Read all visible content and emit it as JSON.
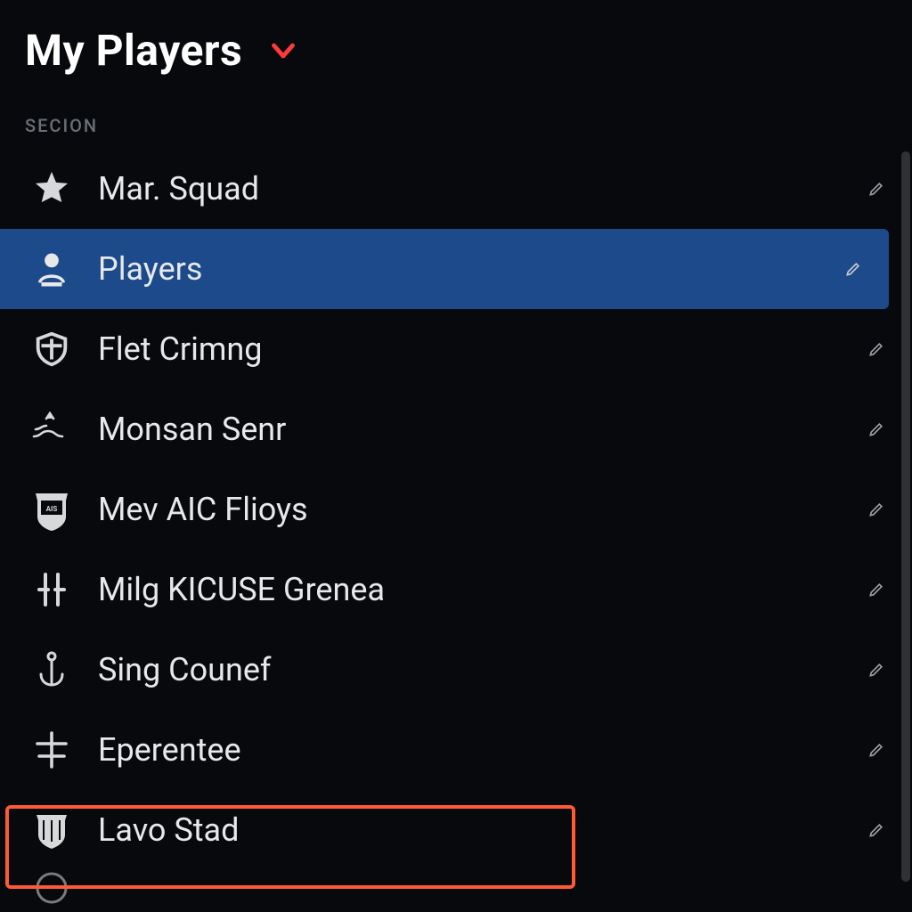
{
  "header": {
    "title": "My Players"
  },
  "section_label": "SECION",
  "items": [
    {
      "icon": "star-icon",
      "label": "Mar. Squad",
      "selected": false
    },
    {
      "icon": "person-icon",
      "label": "Players",
      "selected": true
    },
    {
      "icon": "shield-icon",
      "label": "Flet Crimng",
      "selected": false
    },
    {
      "icon": "wave-icon",
      "label": "Monsan Senr",
      "selected": false
    },
    {
      "icon": "badge-icon",
      "label": "Mev AIC Flioys",
      "selected": false
    },
    {
      "icon": "bars-icon",
      "label": "Milg KICUSE Grenea",
      "selected": false
    },
    {
      "icon": "anchor-icon",
      "label": "Sing Counef",
      "selected": false
    },
    {
      "icon": "cross-icon",
      "label": "Eperentee",
      "selected": false
    },
    {
      "icon": "crest-icon",
      "label": "Lavo Stad",
      "selected": false,
      "highlighted": true
    }
  ],
  "colors": {
    "accent_red": "#ff3a3a",
    "highlight_orange": "#ff5a32",
    "selected_blue": "#1c4a8a"
  }
}
